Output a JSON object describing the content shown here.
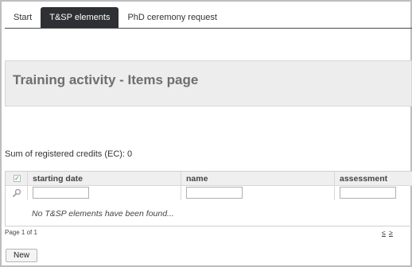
{
  "tabs": [
    {
      "label": "Start",
      "active": false
    },
    {
      "label": "T&SP elements",
      "active": true
    },
    {
      "label": "PhD ceremony request",
      "active": false
    }
  ],
  "page_title": "Training activity - Items page",
  "credits_text": "Sum of registered credits (EC): 0",
  "grid": {
    "columns": [
      "starting date",
      "name",
      "assessment"
    ],
    "select_all_checked": true,
    "filters": [
      "",
      "",
      ""
    ],
    "empty_message": "No T&SP elements have been found..."
  },
  "pager": {
    "status": "Page 1 of 1",
    "prev": "≤",
    "next": "≥"
  },
  "new_button_label": "New",
  "colors": {
    "active_tab_bg": "#2f3033",
    "heading_box_bg": "#ededed",
    "heading_text": "#6e6e6e",
    "check_green": "#2a8a2a"
  },
  "icons": {
    "select_all": "checkbox-check-icon",
    "filter": "magnifier-icon"
  }
}
